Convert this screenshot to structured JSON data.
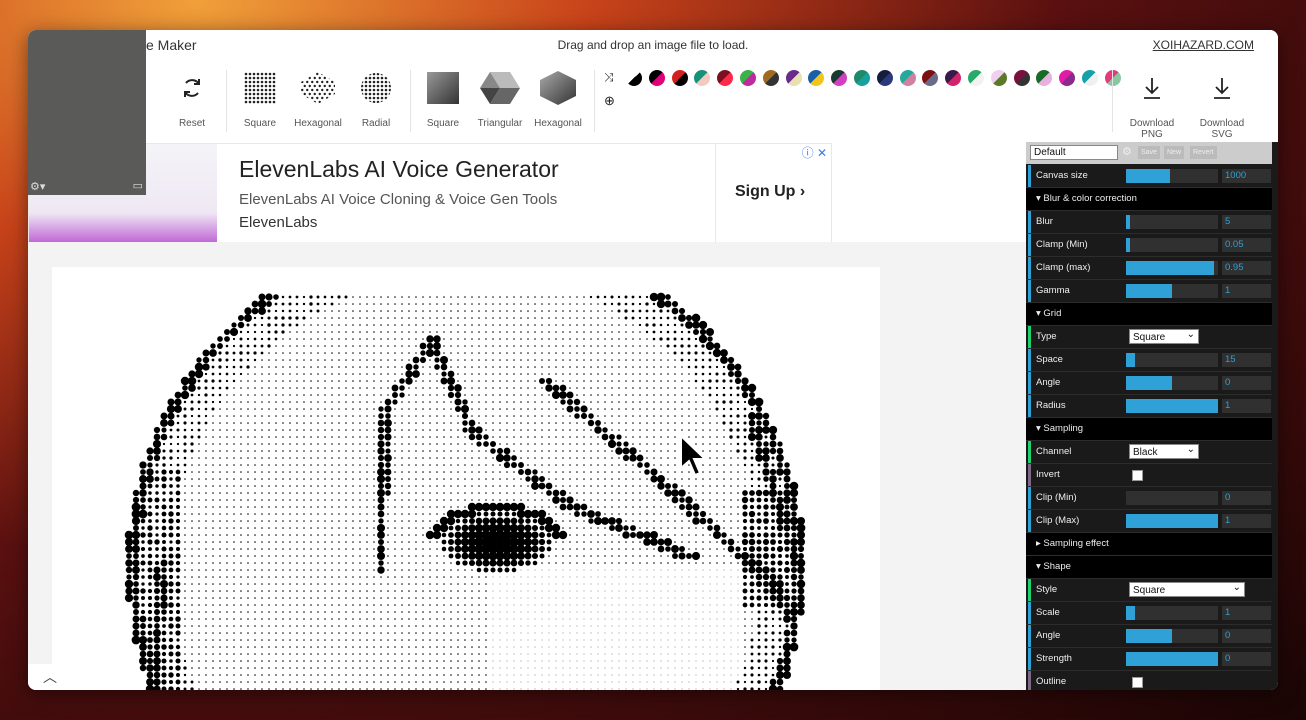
{
  "app": {
    "title": "e Maker",
    "hint": "Drag and drop an image file to load.",
    "brand": "XOIHAZARD.COM"
  },
  "toolbar": {
    "reset": "Reset",
    "grid": [
      {
        "label": "Square"
      },
      {
        "label": "Hexagonal"
      },
      {
        "label": "Radial"
      }
    ],
    "shape": [
      {
        "label": "Square"
      },
      {
        "label": "Triangular"
      },
      {
        "label": "Hexagonal"
      }
    ],
    "download_png": "Download PNG",
    "download_svg": "Download SVG"
  },
  "palette": {
    "swatches": [
      [
        "#ffffff",
        "#000000"
      ],
      [
        "#000000",
        "#e0007a"
      ],
      [
        "#d52020",
        "#000000"
      ],
      [
        "#1a8f7a",
        "#f3c9c0"
      ],
      [
        "#7a1020",
        "#ff2a4a"
      ],
      [
        "#3db04a",
        "#c02aa0"
      ],
      [
        "#a06a20",
        "#333333"
      ],
      [
        "#6a2a8a",
        "#e8e0b0"
      ],
      [
        "#1b5fa8",
        "#f2c51a"
      ],
      [
        "#1a3a30",
        "#d040c0"
      ],
      [
        "#1e8a6a",
        "#16a0a0"
      ],
      [
        "#151d3d",
        "#2a3a7a"
      ],
      [
        "#26a89a",
        "#d080a0"
      ],
      [
        "#7a1010",
        "#6a6a8a"
      ],
      [
        "#3a1a4a",
        "#d2246a"
      ],
      [
        "#2aaa6a",
        "#f2f2f2"
      ],
      [
        "#f0d0f0",
        "#5a7a2a"
      ],
      [
        "#7a1040",
        "#333333"
      ],
      [
        "#1a6a2a",
        "#e8b0e0"
      ],
      [
        "#e21aa8",
        "#8a2a8a"
      ],
      [
        "#18a0a8",
        "#f0f0f0"
      ],
      [
        "#e23a7a",
        "#88c8a0"
      ]
    ]
  },
  "ad": {
    "title": "ElevenLabs AI Voice Generator",
    "subtitle": "ElevenLabs AI Voice Cloning & Voice Gen Tools",
    "brand": "ElevenLabs",
    "cta": "Sign Up",
    "info": "ⓘ ✕"
  },
  "panel": {
    "preset": "Default",
    "preset_buttons": [
      "Save",
      "New",
      "Revert"
    ],
    "rows": [
      {
        "type": "slider",
        "label": "Canvas size",
        "value": "1000",
        "fill": 0.48,
        "color": "#2fa1d6"
      },
      {
        "type": "folder",
        "label": "Blur & color correction"
      },
      {
        "type": "slider",
        "label": "Blur",
        "value": "5",
        "fill": 0.04,
        "color": "#2fa1d6"
      },
      {
        "type": "slider",
        "label": "Clamp (Min)",
        "value": "0.05",
        "fill": 0.04,
        "color": "#2fa1d6"
      },
      {
        "type": "slider",
        "label": "Clamp (max)",
        "value": "0.95",
        "fill": 0.96,
        "color": "#2fa1d6"
      },
      {
        "type": "slider",
        "label": "Gamma",
        "value": "1",
        "fill": 0.5,
        "color": "#2fa1d6"
      },
      {
        "type": "folder",
        "label": "Grid"
      },
      {
        "type": "select",
        "label": "Type",
        "value": "Square",
        "color": "#1ed36f"
      },
      {
        "type": "slider",
        "label": "Space",
        "value": "15",
        "fill": 0.1,
        "color": "#2fa1d6"
      },
      {
        "type": "slider",
        "label": "Angle",
        "value": "0",
        "fill": 0.5,
        "color": "#2fa1d6"
      },
      {
        "type": "slider",
        "label": "Radius",
        "value": "1",
        "fill": 1.0,
        "color": "#2fa1d6"
      },
      {
        "type": "folder",
        "label": "Sampling"
      },
      {
        "type": "select",
        "label": "Channel",
        "value": "Black",
        "color": "#1ed36f"
      },
      {
        "type": "check",
        "label": "Invert",
        "color": "#806787"
      },
      {
        "type": "slider",
        "label": "Clip (Min)",
        "value": "0",
        "fill": 0.0,
        "color": "#2fa1d6"
      },
      {
        "type": "slider",
        "label": "Clip (Max)",
        "value": "1",
        "fill": 1.0,
        "color": "#2fa1d6"
      },
      {
        "type": "folder",
        "label": "Sampling effect",
        "closed": true
      },
      {
        "type": "folder",
        "label": "Shape"
      },
      {
        "type": "select",
        "label": "Style",
        "value": "Square",
        "wide": true,
        "color": "#1ed36f"
      },
      {
        "type": "slider",
        "label": "Scale",
        "value": "1",
        "fill": 0.1,
        "color": "#2fa1d6"
      },
      {
        "type": "slider",
        "label": "Angle",
        "value": "0",
        "fill": 0.5,
        "color": "#2fa1d6"
      },
      {
        "type": "slider",
        "label": "Strength",
        "value": "0",
        "fill": 1.0,
        "color": "#2fa1d6"
      },
      {
        "type": "check",
        "label": "Outline",
        "color": "#806787"
      }
    ]
  }
}
